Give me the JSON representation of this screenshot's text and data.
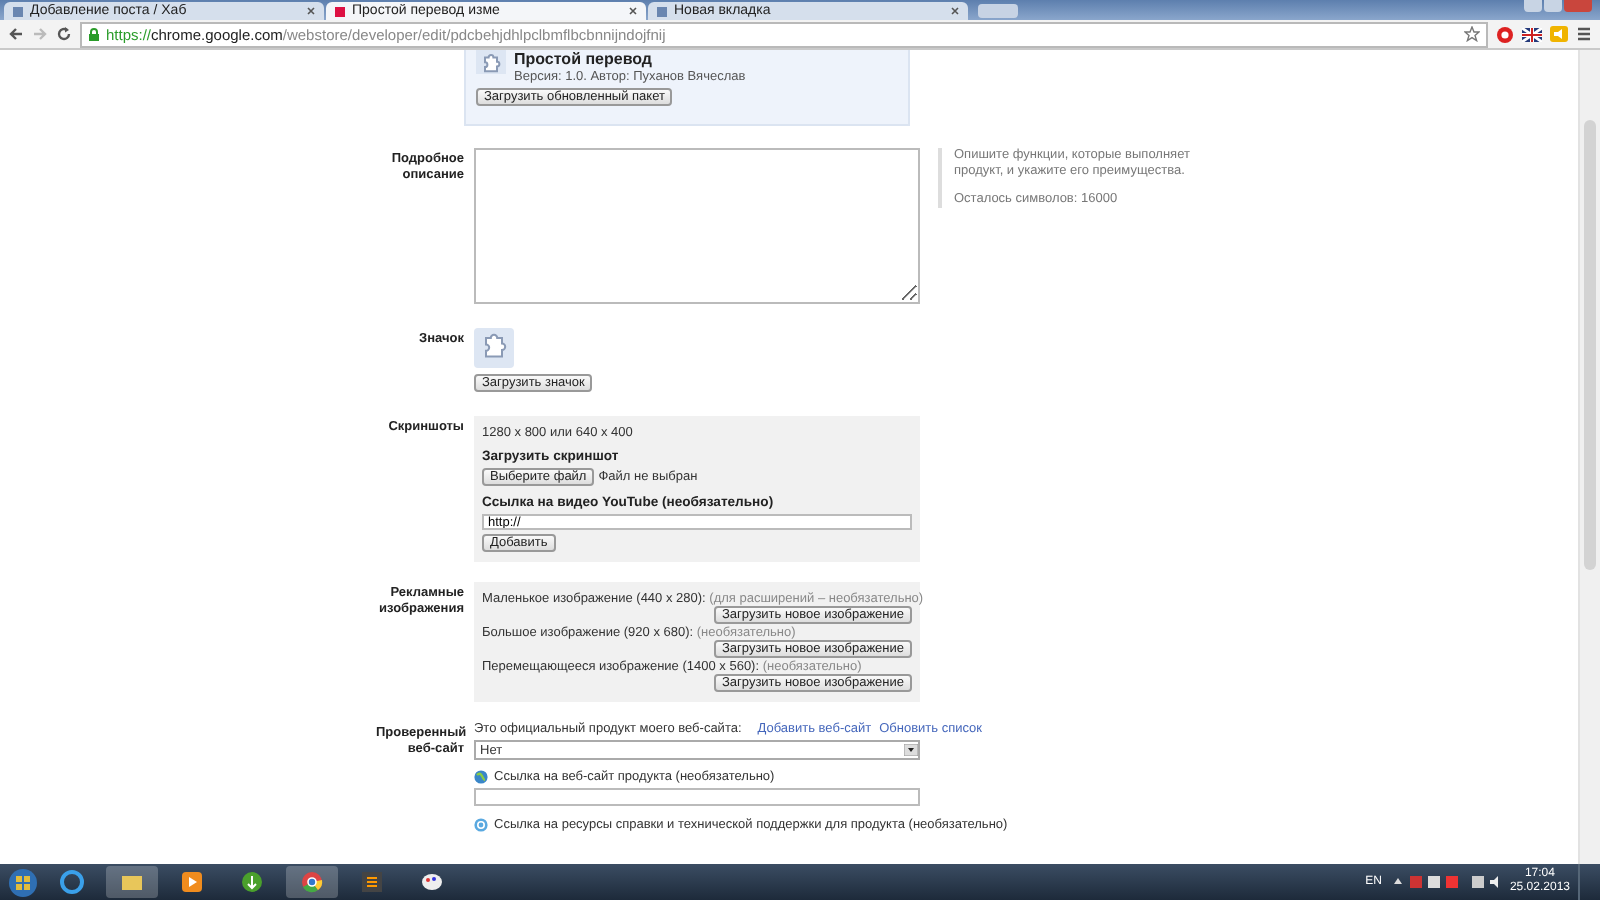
{
  "browser": {
    "tabs": [
      {
        "title": "Добавление поста / Хаб",
        "selected": false
      },
      {
        "title": "Простой перевод изме",
        "selected": true
      },
      {
        "title": "Новая вкладка",
        "selected": false
      }
    ],
    "url": {
      "scheme": "https://",
      "host": "chrome.google.com",
      "path": "/webstore/developer/edit/pdcbehjdhlpclbmflbcbnnijndojfnij"
    }
  },
  "page": {
    "package": {
      "title": "Простой перевод",
      "meta": "Версия: 1.0. Автор: Пуханов Вячеслав",
      "button": "Загрузить обновленный пакет"
    },
    "description": {
      "label": "Подробное описание",
      "help": "Опишите функции, которые выполняет продукт, и укажите его преимущества.",
      "counter": "Осталось символов: 16000"
    },
    "icon": {
      "label": "Значок",
      "button": "Загрузить значок"
    },
    "screenshots": {
      "label": "Скриншоты",
      "size_hint": "1280 x 800 или 640 x 400",
      "upload_label": "Загрузить скриншот",
      "choose_button": "Выберите файл",
      "file_status": "Файл не выбран",
      "video_label": "Ссылка на видео YouTube (необязательно)",
      "video_value": "http://",
      "add_button": "Добавить"
    },
    "promo": {
      "label": "Рекламные изображения",
      "items": [
        {
          "name": "Маленькое изображение (440 x 280):",
          "note": "(для расширений – необязательно)",
          "button": "Загрузить новое изображение"
        },
        {
          "name": "Большое изображение (920 x 680):",
          "note": "(необязательно)",
          "button": "Загрузить новое изображение"
        },
        {
          "name": "Перемещающееся изображение (1400 x 560):",
          "note": "(необязательно)",
          "button": "Загрузить новое изображение"
        }
      ]
    },
    "verified": {
      "label": "Проверенный веб-сайт",
      "question": "Это официальный продукт моего веб-сайта:",
      "links": [
        "Добавить веб-сайт",
        "Обновить список"
      ],
      "select_value": "Нет",
      "site_label": "Ссылка на веб-сайт продукта (необязательно)",
      "support_label": "Ссылка на ресурсы справки и технической поддержки для продукта (необязательно)"
    }
  },
  "taskbar": {
    "language": "EN",
    "time": "17:04",
    "date": "25.02.2013"
  }
}
